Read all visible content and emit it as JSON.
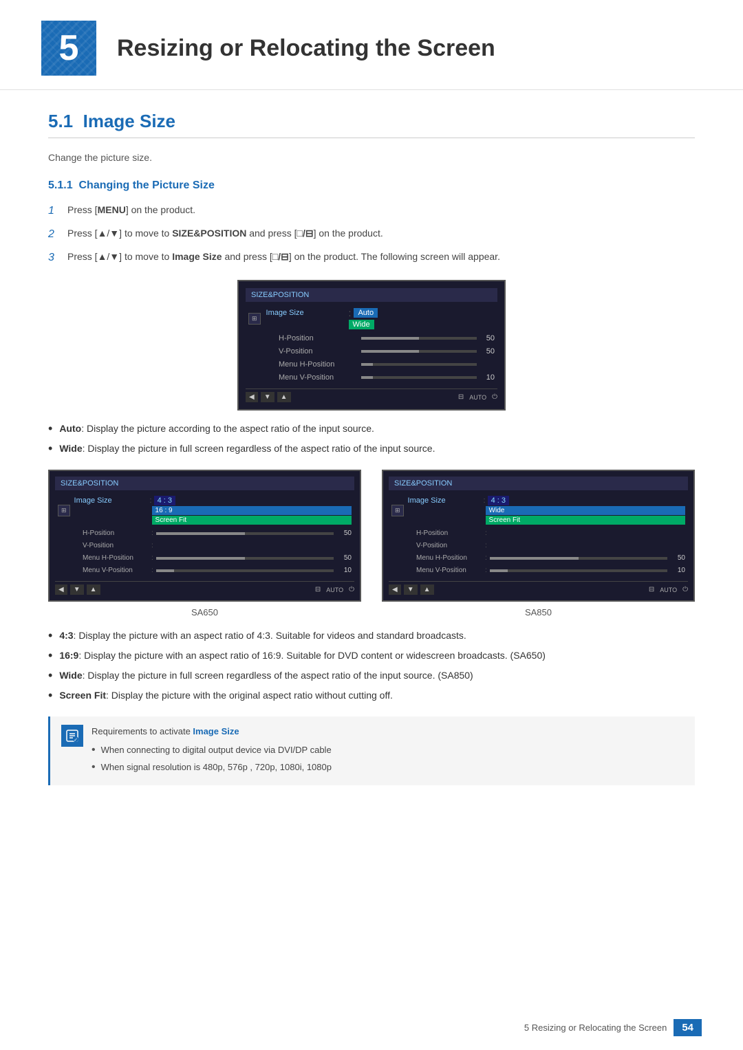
{
  "chapter": {
    "number": "5",
    "title": "Resizing or Relocating the Screen"
  },
  "section": {
    "number": "5.1",
    "title": "Image Size",
    "intro": "Change the picture size."
  },
  "subsection": {
    "number": "5.1.1",
    "title": "Changing the Picture Size"
  },
  "steps": [
    {
      "num": "1",
      "text_before": "Press [",
      "bold1": "MENU",
      "text_after": "] on the product."
    },
    {
      "num": "2",
      "text_before": "Press [▲/▼] to move to ",
      "bold1": "SIZE&POSITION",
      "text_middle": " and press [",
      "bold2": "□/⊟",
      "text_after": "] on the product."
    },
    {
      "num": "3",
      "text_before": "Press [▲/▼] to move to ",
      "bold1": "Image Size",
      "text_middle": " and press [",
      "bold2": "□/⊟",
      "text_after": "] on the product. The following screen will appear."
    }
  ],
  "main_menu": {
    "title": "SIZE&POSITION",
    "items": [
      {
        "label": "Image Size",
        "highlighted": true
      },
      {
        "label": "H-Position",
        "highlighted": false
      },
      {
        "label": "V-Position",
        "highlighted": false
      },
      {
        "label": "Menu H-Position",
        "highlighted": false
      },
      {
        "label": "Menu V-Position",
        "highlighted": false
      }
    ],
    "values": {
      "image_size_val1": "Auto",
      "image_size_val2": "Wide",
      "h_pos": "50",
      "v_pos": "50",
      "menu_h": "10"
    }
  },
  "bullet_items": [
    {
      "bold": "Auto",
      "text": ": Display the picture according to the aspect ratio of the input source."
    },
    {
      "bold": "Wide",
      "text": ": Display the picture in full screen regardless of the aspect ratio of the input source."
    }
  ],
  "sa650_menu": {
    "title": "SIZE&POSITION",
    "caption": "SA650",
    "image_size_options": [
      "4 : 3",
      "16 : 9",
      "Screen Fit"
    ],
    "selected": "16 : 9",
    "highlighted": "Screen Fit",
    "menu_h_val": "50",
    "menu_v_val": "10"
  },
  "sa850_menu": {
    "title": "SIZE&POSITION",
    "caption": "SA850",
    "image_size_options": [
      "4 : 3",
      "Wide",
      "Screen Fit"
    ],
    "selected": "4 : 3",
    "highlighted": "Wide",
    "menu_h_val": "50",
    "menu_v_val": "10"
  },
  "bullet_items2": [
    {
      "bold": "4:3",
      "text": ": Display the picture with an aspect ratio of 4:3. Suitable for videos and standard broadcasts."
    },
    {
      "bold": "16:9",
      "text": ": Display the picture with an aspect ratio of 16:9. Suitable for DVD content or widescreen broadcasts. (SA650)"
    },
    {
      "bold": "Wide",
      "text": ": Display the picture in full screen regardless of the aspect ratio of the input source. (SA850)"
    },
    {
      "bold": "Screen Fit",
      "text": ": Display the picture with the original aspect ratio without cutting off."
    }
  ],
  "note": {
    "title_label": "Requirements to activate ",
    "title_bold": "Image Size",
    "sub_items": [
      "When connecting to digital output device via DVI/DP cable",
      "When signal resolution is 480p, 576p , 720p, 1080i, 1080p"
    ]
  },
  "footer": {
    "chapter_text": "5 Resizing or Relocating the Screen",
    "page": "54"
  }
}
